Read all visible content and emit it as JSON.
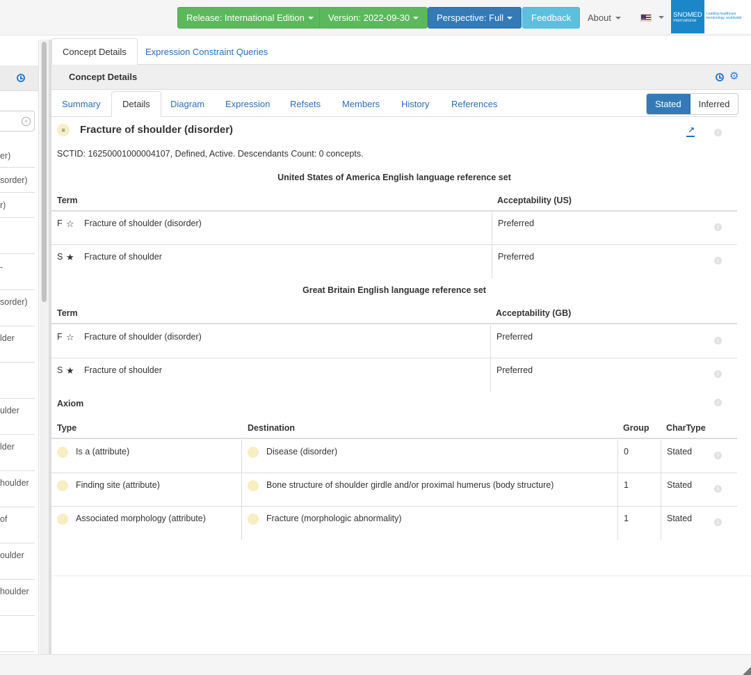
{
  "navbar": {
    "release": "Release: International Edition",
    "version": "Version: 2022-09-30",
    "perspective": "Perspective: Full",
    "feedback": "Feedback",
    "about": "About",
    "logo_name": "SNOMED",
    "logo_sub": "International",
    "logo_tagline": "Leading healthcare terminology, worldwide"
  },
  "left_panel": {
    "items": [
      "er)",
      "sorder)",
      "r)",
      "",
      "-",
      "sorder)",
      "lder",
      "",
      "ulder",
      "lder",
      "houlder",
      "of",
      "oulder",
      "houlder",
      ""
    ]
  },
  "panel_tabs": [
    "Concept Details",
    "Expression Constraint Queries"
  ],
  "panel_title": "Concept Details",
  "sub_tabs": [
    "Summary",
    "Details",
    "Diagram",
    "Expression",
    "Refsets",
    "Members",
    "History",
    "References"
  ],
  "view_toggle": {
    "stated": "Stated",
    "inferred": "Inferred"
  },
  "concept": {
    "icon": "≡",
    "title": "Fracture of shoulder (disorder)",
    "info": "SCTID: 16250001000004107, Defined, Active. Descendants Count: 0 concepts."
  },
  "us_refset": {
    "title": "United States of America English language reference set",
    "col_term": "Term",
    "col_accept": "Acceptability  (US)",
    "rows": [
      {
        "type": "F",
        "star": "☆",
        "term": "Fracture of shoulder (disorder)",
        "acceptability": "Preferred"
      },
      {
        "type": "S",
        "star": "★",
        "term": "Fracture of shoulder",
        "acceptability": "Preferred"
      }
    ]
  },
  "gb_refset": {
    "title": "Great Britain English language reference set",
    "col_term": "Term",
    "col_accept": "Acceptability  (GB)",
    "rows": [
      {
        "type": "F",
        "star": "☆",
        "term": "Fracture of shoulder (disorder)",
        "acceptability": "Preferred"
      },
      {
        "type": "S",
        "star": "★",
        "term": "Fracture of shoulder",
        "acceptability": "Preferred"
      }
    ]
  },
  "axiom": {
    "label": "Axiom",
    "col_type": "Type",
    "col_destination": "Destination",
    "col_group": "Group",
    "col_chartype": "CharType",
    "rows": [
      {
        "type": "Is a (attribute)",
        "destination": "Disease (disorder)",
        "group": "0",
        "chartype": "Stated"
      },
      {
        "type": "Finding site (attribute)",
        "destination": "Bone structure of shoulder girdle and/or proximal humerus (body structure)",
        "group": "1",
        "chartype": "Stated"
      },
      {
        "type": "Associated morphology (attribute)",
        "destination": "Fracture (morphologic abnormality)",
        "group": "1",
        "chartype": "Stated"
      }
    ]
  },
  "colors": {
    "primary": "#337ab7",
    "success": "#5cb85c",
    "info": "#5bc0de",
    "link": "#2a6ebb"
  }
}
